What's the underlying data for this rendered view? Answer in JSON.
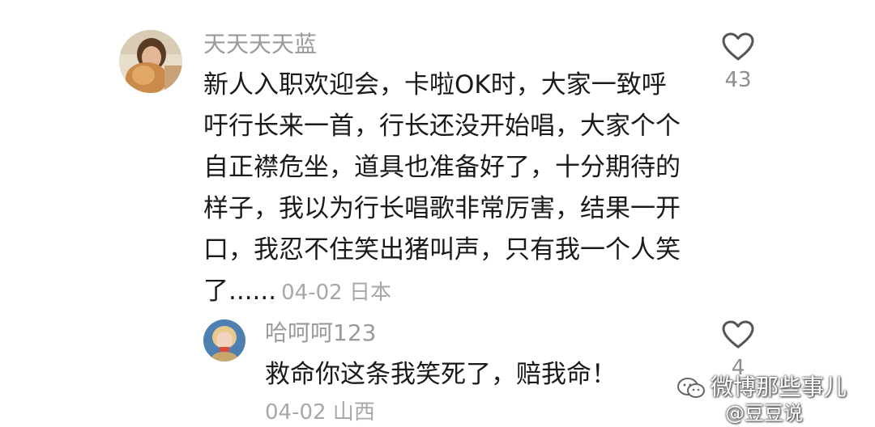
{
  "comment": {
    "username": "天天天天蓝",
    "lines": [
      "新人入职欢迎会，卡啦OK时，大家一致呼",
      "吁行长来一首，行长还没开始唱，大家个个",
      "自正襟危坐，道具也准备好了，十分期待的",
      "样子，我以为行长唱歌非常厉害，结果一开",
      "口，我忍不住笑出猪叫声，只有我一个人笑",
      "了......"
    ],
    "meta": "04-02 日本",
    "likes": "43",
    "icon": "heart-outline-icon"
  },
  "reply": {
    "username": "哈呵呵123",
    "text": "救命你这条我笑死了，赔我命！",
    "meta": "04-02 山西",
    "likes": "4",
    "icon": "heart-outline-icon"
  },
  "watermark": {
    "line1": "微博那些事儿",
    "line2": "@豆豆说"
  }
}
